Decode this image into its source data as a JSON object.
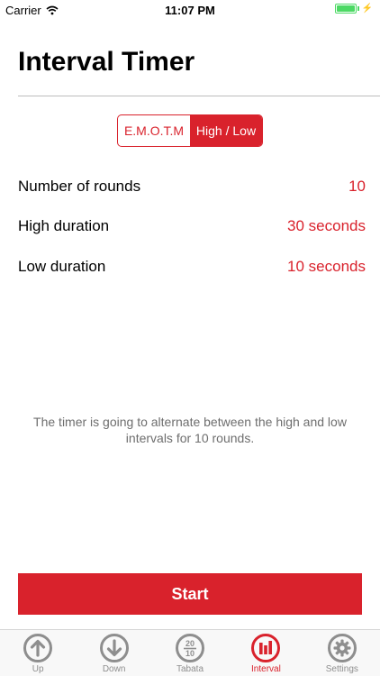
{
  "status_bar": {
    "carrier": "Carrier",
    "time": "11:07 PM"
  },
  "page": {
    "title": "Interval Timer"
  },
  "segmented": {
    "options": [
      "E.M.O.T.M",
      "High / Low"
    ],
    "selected": "High / Low"
  },
  "settings": [
    {
      "label": "Number of rounds",
      "value": "10"
    },
    {
      "label": "High duration",
      "value": "30 seconds"
    },
    {
      "label": "Low duration",
      "value": "10 seconds"
    }
  ],
  "description": "The timer is going to alternate between the high and low intervals for 10 rounds.",
  "start_button": {
    "label": "Start"
  },
  "tab_bar": {
    "tabs": [
      {
        "label": "Up",
        "icon": "arrow-up-icon"
      },
      {
        "label": "Down",
        "icon": "arrow-down-icon"
      },
      {
        "label": "Tabata",
        "icon": "tabata-20-10-icon",
        "icon_text_top": "20",
        "icon_text_bottom": "10"
      },
      {
        "label": "Interval",
        "icon": "interval-bars-icon"
      },
      {
        "label": "Settings",
        "icon": "gear-icon"
      }
    ],
    "active": "Interval"
  },
  "colors": {
    "accent": "#d9222c",
    "inactive": "#8e8e8e",
    "battery": "#4cd964"
  }
}
